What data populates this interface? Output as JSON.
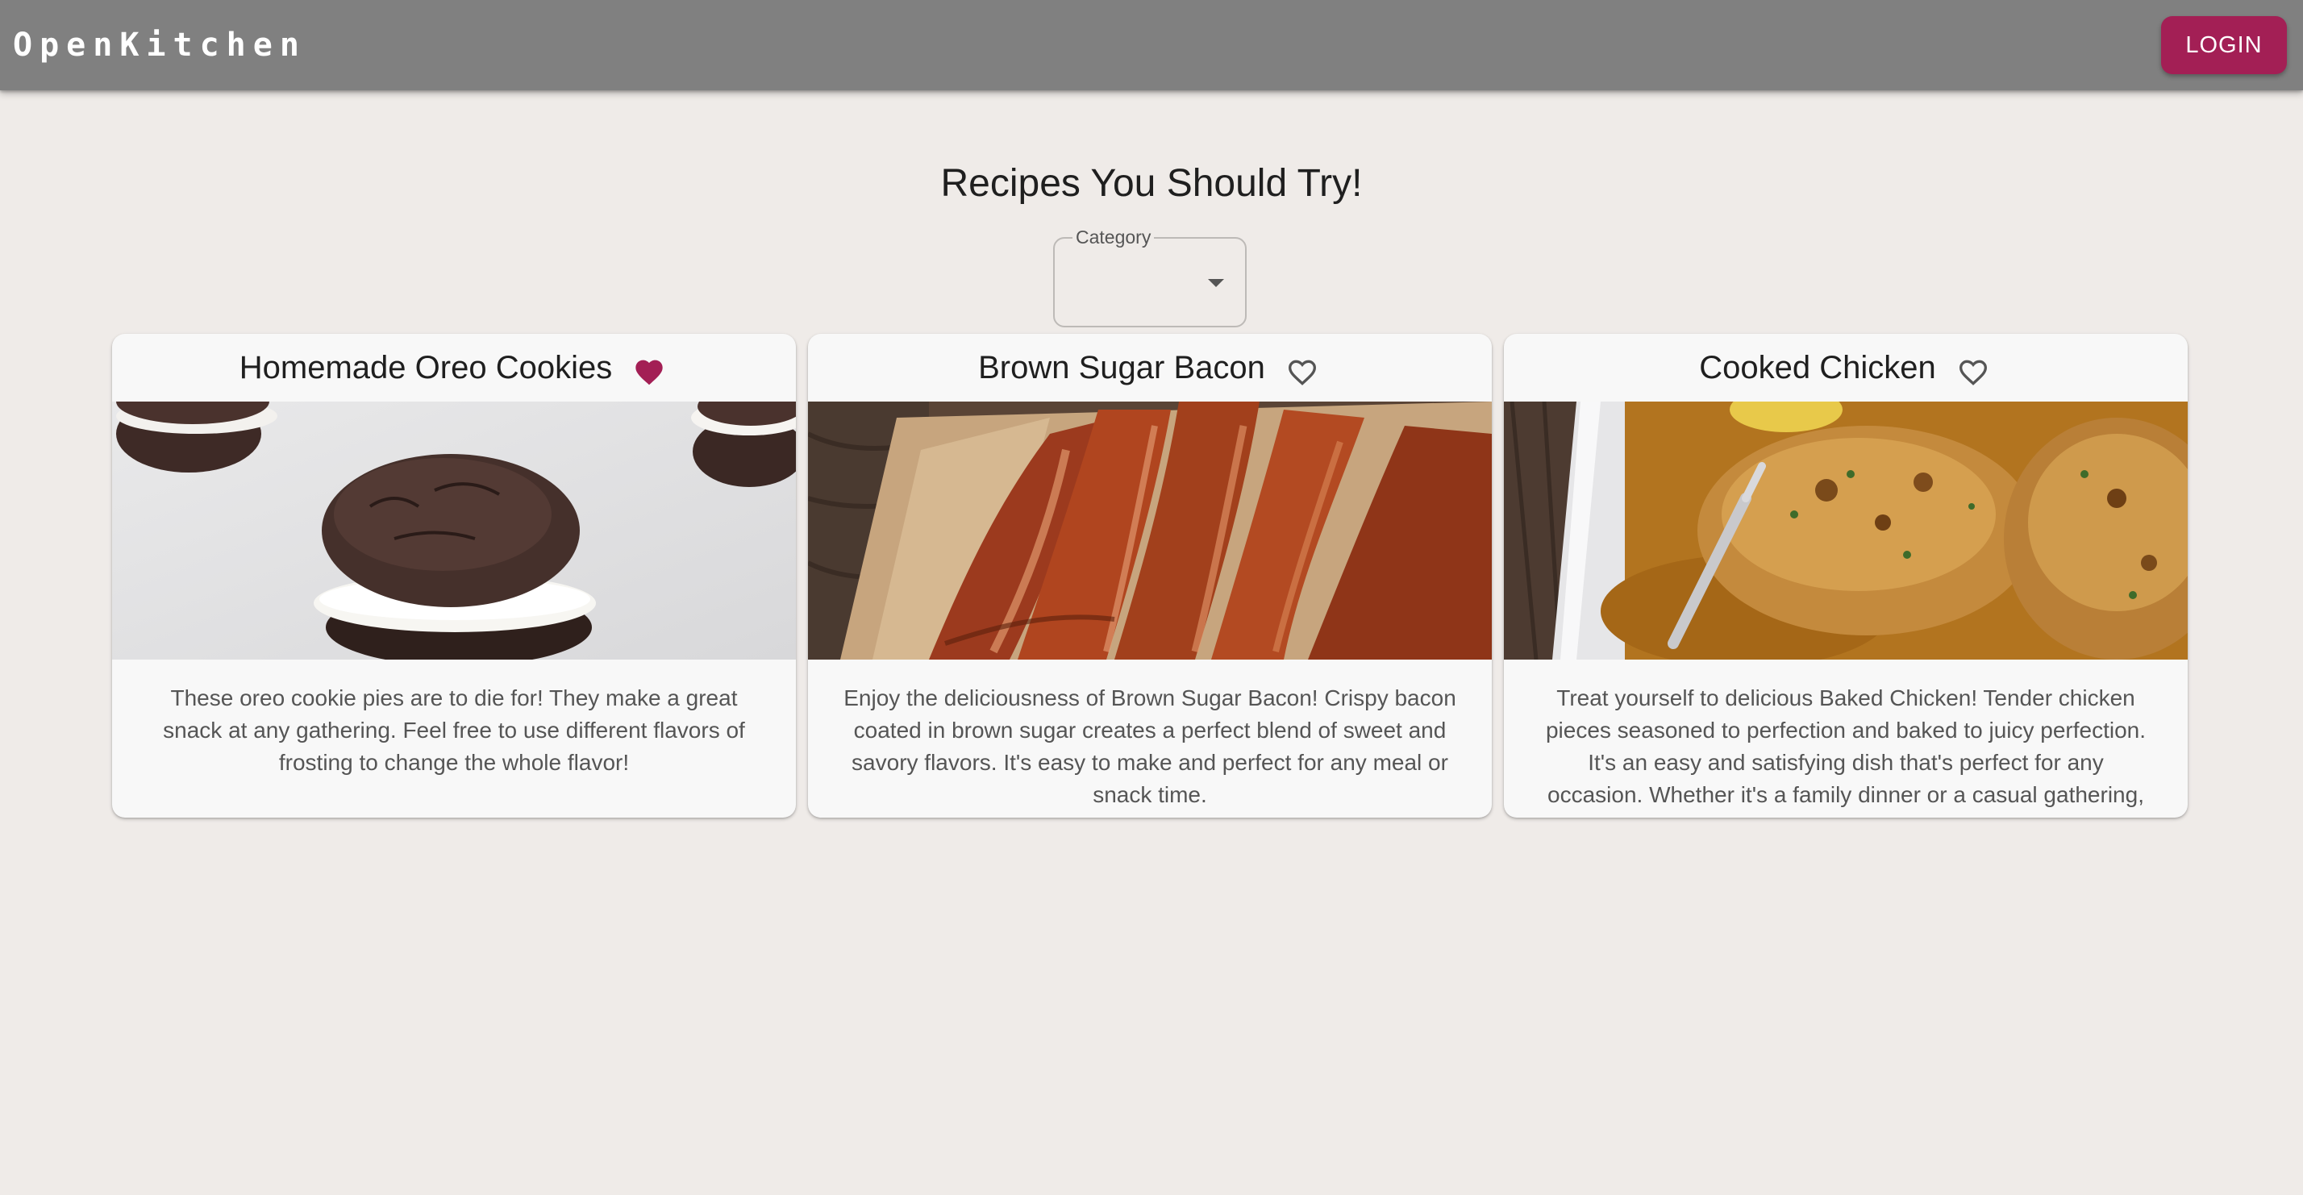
{
  "app": {
    "brand": "OpenKitchen",
    "login_label": "LOGIN",
    "accent_color": "#a31f55",
    "appbar_color": "#808080"
  },
  "page": {
    "title": "Recipes You Should Try!"
  },
  "category_filter": {
    "label": "Category",
    "selected": ""
  },
  "recipes": [
    {
      "title": "Homemade Oreo Cookies",
      "favorited": true,
      "image_icon": "oreo-cookie-pie-photo",
      "description": "These oreo cookie pies are to die for! They make a great snack at any gathering. Feel free to use different flavors of frosting to change the whole flavor!"
    },
    {
      "title": "Brown Sugar Bacon",
      "favorited": false,
      "image_icon": "bacon-photo",
      "description": "Enjoy the deliciousness of Brown Sugar Bacon! Crispy bacon coated in brown sugar creates a perfect blend of sweet and savory flavors. It's easy to make and perfect for any meal or snack time."
    },
    {
      "title": "Cooked Chicken",
      "favorited": false,
      "image_icon": "baked-chicken-photo",
      "description": "Treat yourself to delicious Baked Chicken! Tender chicken pieces seasoned to perfection and baked to juicy perfection. It's an easy and satisfying dish that's perfect for any occasion. Whether it's a family dinner or a casual gathering,"
    }
  ]
}
